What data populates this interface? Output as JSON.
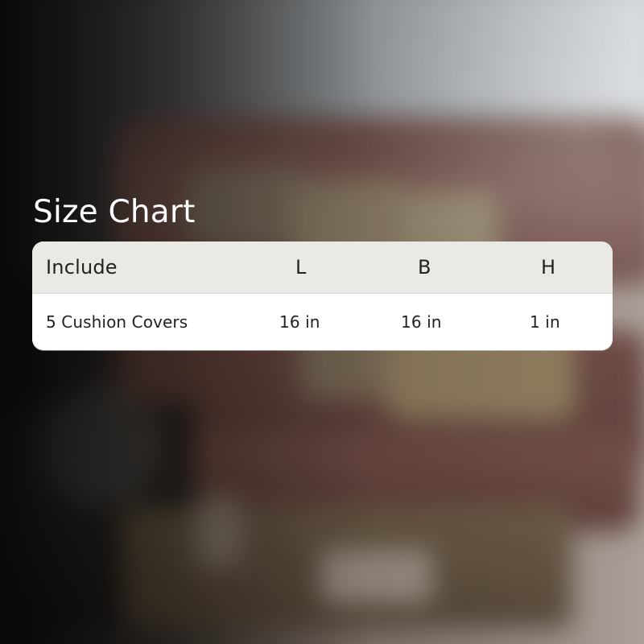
{
  "title": "Size Chart",
  "table": {
    "headers": [
      "Include",
      "L",
      "B",
      "H"
    ],
    "rows": [
      {
        "include": "5 Cushion Covers",
        "l": "16 in",
        "b": "16 in",
        "h": "1 in"
      }
    ]
  }
}
